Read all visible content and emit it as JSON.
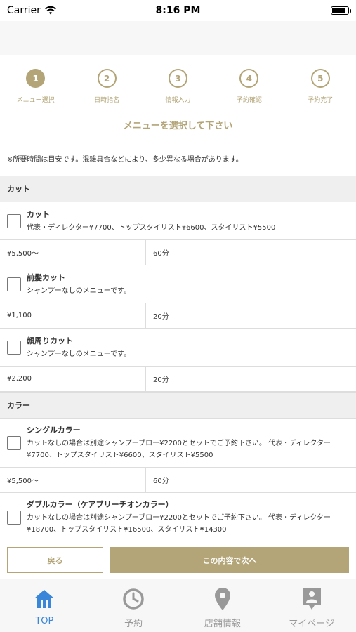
{
  "status_bar": {
    "carrier": "Carrier",
    "time": "8:16 PM",
    "battery_level": 0.85
  },
  "steps": [
    {
      "number": "1",
      "label": "メニュー選択",
      "active": true
    },
    {
      "number": "2",
      "label": "日時指名",
      "active": false
    },
    {
      "number": "3",
      "label": "情報入力",
      "active": false
    },
    {
      "number": "4",
      "label": "予約確認",
      "active": false
    },
    {
      "number": "5",
      "label": "予約完了",
      "active": false
    }
  ],
  "heading": "メニューを選択して下さい",
  "note": "※所要時間は目安です。混雑具合などにより、多少異なる場合があります。",
  "categories": [
    {
      "name": "カット",
      "items": [
        {
          "name": "カット",
          "description": "代表・ディレクター¥7700、トップスタイリスト¥6600、スタイリスト¥5500",
          "price": "¥5,500〜",
          "time": "60分"
        },
        {
          "name": "前髪カット",
          "description": "シャンプーなしのメニューです。",
          "price": "¥1,100",
          "time": "20分"
        },
        {
          "name": "顔周りカット",
          "description": "シャンプーなしのメニューです。",
          "price": "¥2,200",
          "time": "20分"
        }
      ]
    },
    {
      "name": "カラー",
      "items": [
        {
          "name": "シングルカラー",
          "description": "カットなしの場合は別途シャンプーブロー¥2200とセットでご予約下さい。 代表・ディレクター¥7700、トップスタイリスト¥6600、スタイリスト¥5500",
          "price": "¥5,500〜",
          "time": "60分"
        },
        {
          "name": "ダブルカラー（ケアブリーチオンカラー）",
          "description": "カットなしの場合は別途シャンプーブロー¥2200とセットでご予約下さい。 代表・ディレクター¥18700、トップスタイリスト¥16500、スタイリスト¥14300",
          "price": "",
          "time": ""
        }
      ]
    }
  ],
  "actions": {
    "back": "戻る",
    "next": "この内容で次へ"
  },
  "tabs": [
    {
      "label": "TOP",
      "icon": "home-icon",
      "active": true
    },
    {
      "label": "予約",
      "icon": "clock-icon",
      "active": false
    },
    {
      "label": "店舗情報",
      "icon": "map-pin-icon",
      "active": false
    },
    {
      "label": "マイページ",
      "icon": "profile-icon",
      "active": false
    }
  ],
  "colors": {
    "accent": "#b3a578",
    "tab_active": "#3a86d8",
    "tab_inactive": "#999999"
  }
}
